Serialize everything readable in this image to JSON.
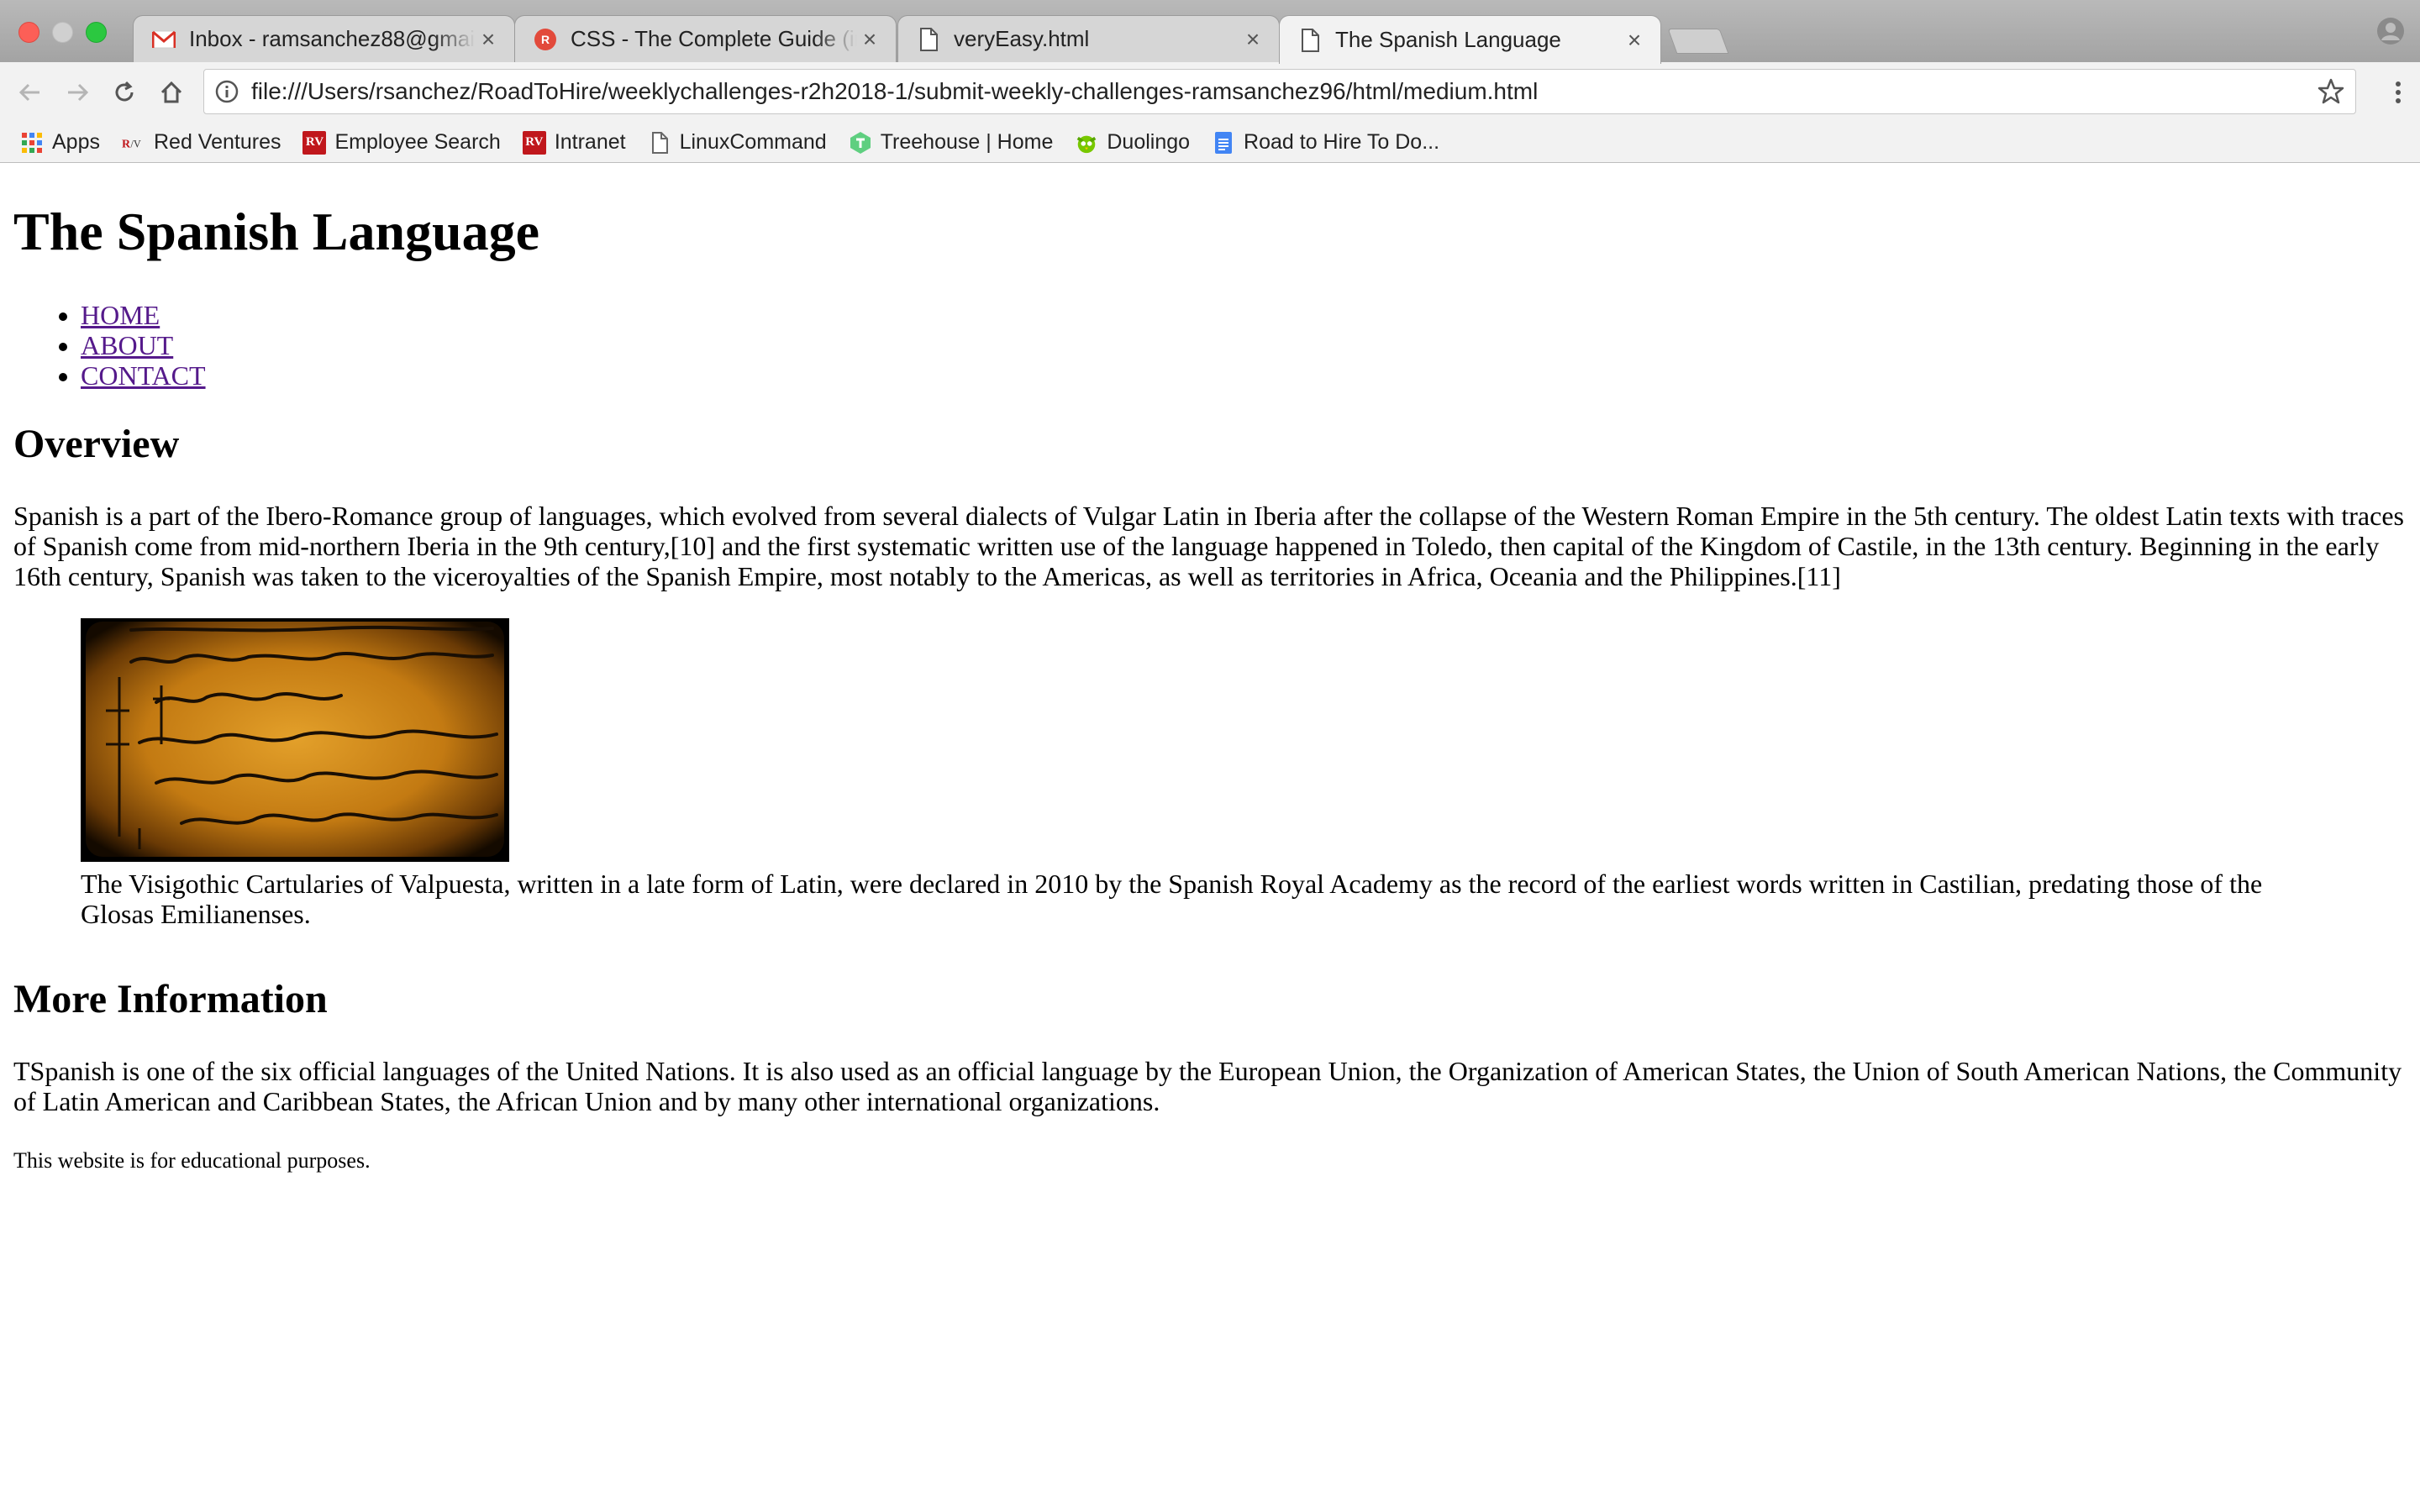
{
  "browser": {
    "tabs": [
      {
        "title": "Inbox - ramsanchez88@gmail.c",
        "icon": "gmail-icon",
        "active": false
      },
      {
        "title": "CSS - The Complete Guide (inc",
        "icon": "udemy-icon",
        "active": false
      },
      {
        "title": "veryEasy.html",
        "icon": "file-icon",
        "active": false
      },
      {
        "title": "The Spanish Language",
        "icon": "file-icon",
        "active": true
      }
    ],
    "url": "file:///Users/rsanchez/RoadToHire/weeklychallenges-r2h2018-1/submit-weekly-challenges-ramsanchez96/html/medium.html",
    "bookmarks": [
      {
        "label": "Apps",
        "icon": "apps-grid-icon"
      },
      {
        "label": "Red Ventures",
        "icon": "rv-logo-icon"
      },
      {
        "label": "Employee Search",
        "icon": "rv-badge-icon"
      },
      {
        "label": "Intranet",
        "icon": "rv-badge-icon"
      },
      {
        "label": "LinuxCommand",
        "icon": "file-icon"
      },
      {
        "label": "Treehouse | Home",
        "icon": "treehouse-icon"
      },
      {
        "label": "Duolingo",
        "icon": "duolingo-icon"
      },
      {
        "label": "Road to Hire To Do...",
        "icon": "google-docs-icon"
      }
    ],
    "rv_badge_text": "RV",
    "colors": {
      "tabstrip": "#a8a8a8",
      "toolbar": "#f2f2f2",
      "link_visited": "#551a8b"
    }
  },
  "page": {
    "title": "The Spanish Language",
    "nav": [
      "HOME",
      "ABOUT",
      "CONTACT"
    ],
    "overview_heading": "Overview",
    "overview_text": "Spanish is a part of the Ibero-Romance group of languages, which evolved from several dialects of Vulgar Latin in Iberia after the collapse of the Western Roman Empire in the 5th century. The oldest Latin texts with traces of Spanish come from mid-northern Iberia in the 9th century,[10] and the first systematic written use of the language happened in Toledo, then capital of the Kingdom of Castile, in the 13th century. Beginning in the early 16th century, Spanish was taken to the viceroyalties of the Spanish Empire, most notably to the Americas, as well as territories in Africa, Oceania and the Philippines.[11]",
    "figure_caption": "The Visigothic Cartularies of Valpuesta, written in a late form of Latin, were declared in 2010 by the Spanish Royal Academy as the record of the earliest words written in Castilian, predating those of the Glosas Emilianenses.",
    "more_heading": "More Information",
    "more_text": "TSpanish is one of the six official languages of the United Nations. It is also used as an official language by the European Union, the Organization of American States, the Union of South American Nations, the Community of Latin American and Caribbean States, the African Union and by many other international organizations.",
    "footer_note": "This website is for educational purposes."
  }
}
